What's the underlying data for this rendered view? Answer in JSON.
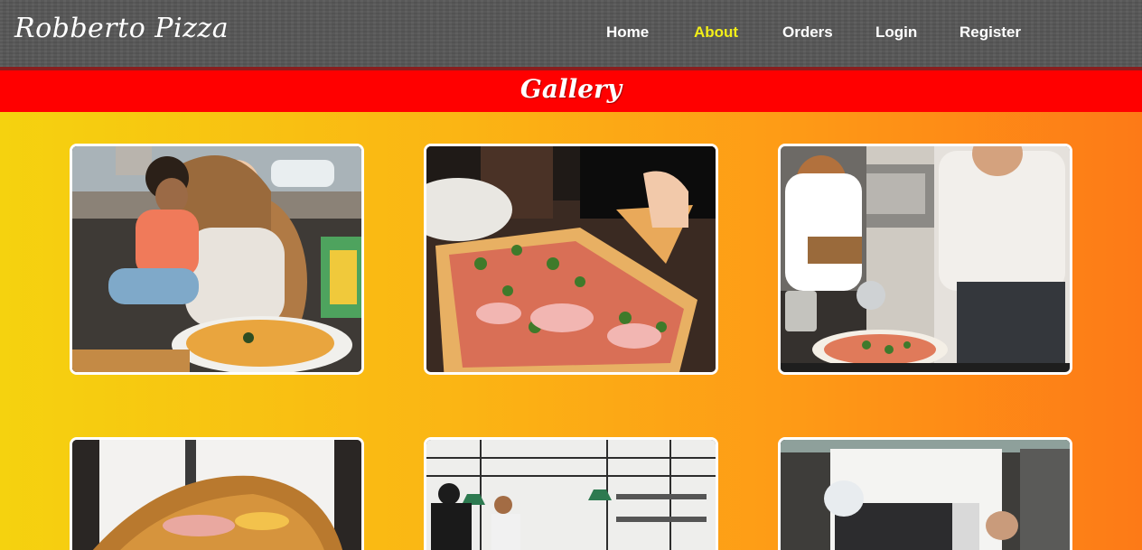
{
  "brand": {
    "name": "Robberto Pizza"
  },
  "nav": {
    "items": [
      {
        "label": "Home",
        "active": false
      },
      {
        "label": "About",
        "active": true
      },
      {
        "label": "Orders",
        "active": false
      },
      {
        "label": "Login",
        "active": false
      },
      {
        "label": "Register",
        "active": false
      }
    ]
  },
  "gallery": {
    "title": "Gallery",
    "photos": [
      "mother-and-child-with-pizza",
      "sliced-prosciutto-pizza",
      "chef-cutting-pizza",
      "folded-calzone",
      "restaurant-interior",
      "chef-with-gloves"
    ]
  },
  "colors": {
    "navbar": "#575757",
    "nav_active": "#f2ee18",
    "banner": "#ff0000",
    "gradient_start": "#f5d20f",
    "gradient_end": "#fd7a17"
  }
}
